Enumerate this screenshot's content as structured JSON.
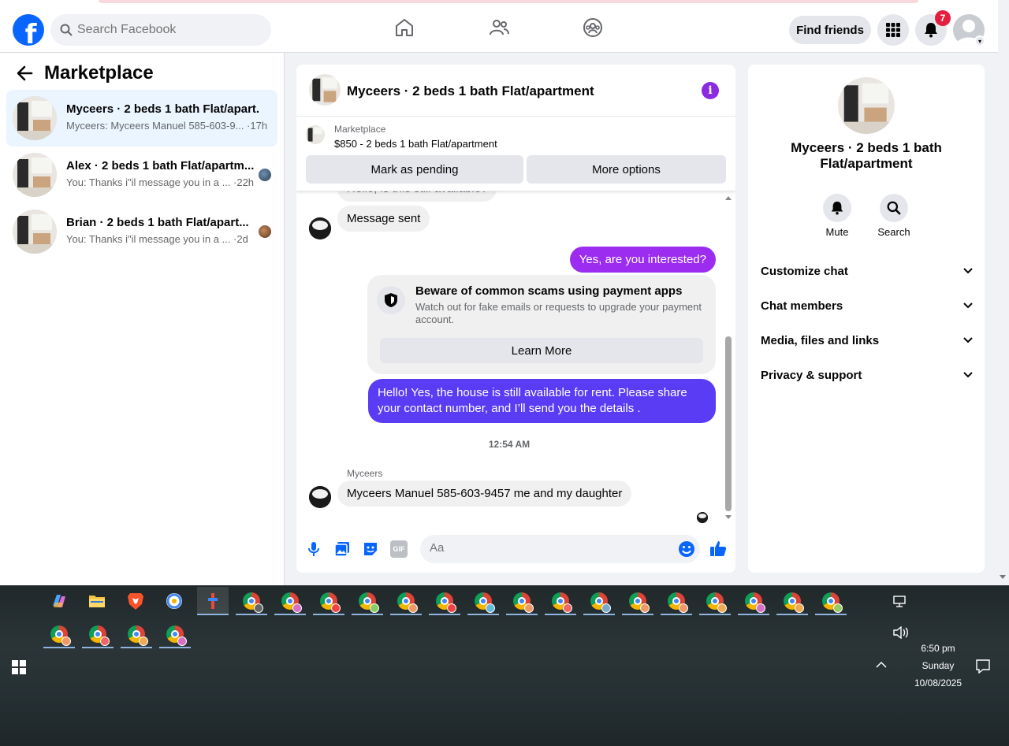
{
  "topnav": {
    "search_placeholder": "Search Facebook",
    "find_friends": "Find friends",
    "notif_count": "7"
  },
  "left": {
    "title": "Marketplace",
    "conversations": [
      {
        "title": "Myceers · 2 beds 1 bath Flat/apart...",
        "subtitle": "Myceers: Myceers Manuel 585-603-9... ·17h",
        "active": true
      },
      {
        "title": "Alex · 2 beds 1 bath Flat/apartm...",
        "subtitle": "You: Thanks i\"il message you in a ... ·22h",
        "active": false
      },
      {
        "title": "Brian · 2 beds 1 bath Flat/apart...",
        "subtitle": "You: Thanks i\"il message you in a ... ·2d",
        "active": false
      }
    ]
  },
  "chat": {
    "title": "Myceers · 2 beds 1 bath Flat/apartment",
    "marketplace_label": "Marketplace",
    "listing": "$850 - 2 beds 1 bath Flat/apartment",
    "mark_pending": "Mark as pending",
    "more_options": "More options",
    "partial_msg": "Hello, is this still available?",
    "msg_sent": "Message sent",
    "out_1": "Yes, are you interested?",
    "warning_title": "Beware of common scams using payment apps",
    "warning_body": "Watch out for fake emails or requests to upgrade your payment account.",
    "learn_more": "Learn More",
    "out_2": "Hello! Yes, the house is still available for rent. Please share your contact number, and I’ll send you the details .",
    "time": "12:54 AM",
    "sender": "Myceers",
    "in_last": "Myceers Manuel 585-603-9457 me and my daughter",
    "composer_placeholder": "Aa",
    "gif_label": "GIF"
  },
  "right": {
    "title": "Myceers · 2 beds 1 bath Flat/apartment",
    "mute": "Mute",
    "search": "Search",
    "items": [
      "Customize chat",
      "Chat members",
      "Media, files and links",
      "Privacy & support"
    ]
  },
  "taskbar": {
    "time": "6:50 pm",
    "day": "Sunday",
    "date": "10/08/2025"
  },
  "colors": {
    "brand": "#0866ff",
    "outgoing_bubble_1": "#9b2cf0",
    "outgoing_bubble_2": "#5b3cf5",
    "notification_badge": "#e41e3f"
  }
}
